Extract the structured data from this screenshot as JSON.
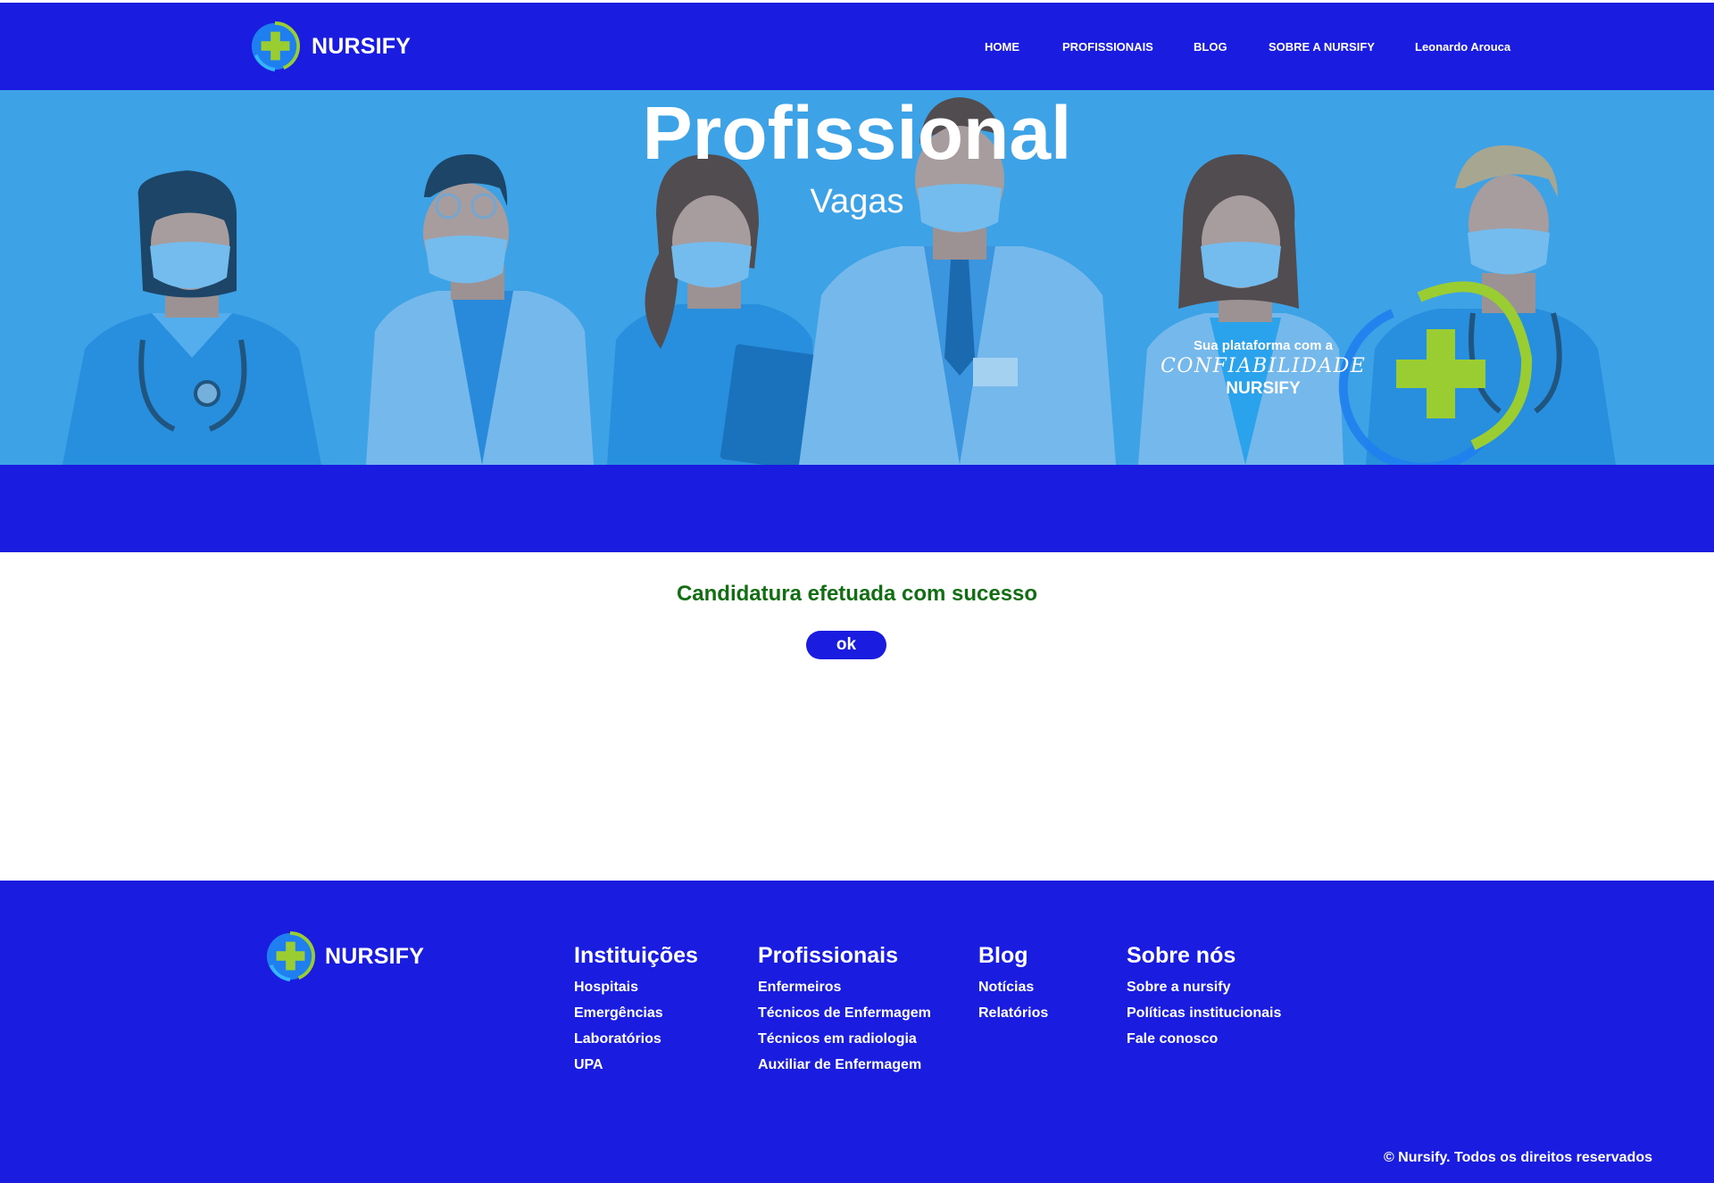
{
  "header": {
    "brand": "NURSIFY",
    "nav": [
      "HOME",
      "PROFISSIONAIS",
      "BLOG",
      "SOBRE A NURSIFY",
      "Leonardo Arouca"
    ]
  },
  "hero": {
    "title": "Profissional",
    "subtitle": "Vagas",
    "tagline": {
      "line1": "Sua plataforma com a",
      "line2": "CONFIABILIDADE",
      "line3": "NURSIFY"
    }
  },
  "main": {
    "message": "Candidatura efetuada com sucesso",
    "ok_label": "ok"
  },
  "footer": {
    "brand": "NURSIFY",
    "columns": [
      {
        "title": "Instituições",
        "links": [
          "Hospitais",
          "Emergências",
          "Laboratórios",
          "UPA"
        ]
      },
      {
        "title": "Profissionais",
        "links": [
          "Enfermeiros",
          "Técnicos de Enfermagem",
          "Técnicos em radiologia",
          "Auxiliar de Enfermagem"
        ]
      },
      {
        "title": "Blog",
        "links": [
          "Notícias",
          "Relatórios"
        ]
      },
      {
        "title": "Sobre nós",
        "links": [
          "Sobre a nursify",
          "Políticas institucionais",
          "Fale conosco"
        ]
      }
    ],
    "copyright": "© Nursify. Todos os direitos reservados"
  },
  "colors": {
    "brand_blue": "#1a1de0",
    "hero_blue": "#3fa3e6",
    "success_green": "#126e12",
    "logo_green": "#9acd32"
  },
  "icons": [
    "nursify-logo-icon"
  ]
}
